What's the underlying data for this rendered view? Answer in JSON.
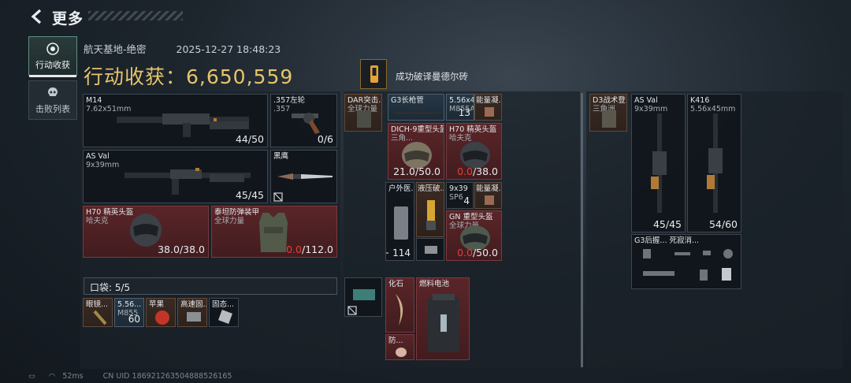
{
  "header": {
    "title": "更多"
  },
  "nav": [
    {
      "label": "行动收获",
      "icon": "target-icon",
      "active": true
    },
    {
      "label": "击败列表",
      "icon": "skull-icon",
      "active": false
    }
  ],
  "summary": {
    "map": "航天基地-绝密",
    "datetime": "2025-12-27 18:48:23",
    "harvest_label": "行动收获：",
    "harvest_value": "6,650,559",
    "achievement": "成功破译曼德尔砖"
  },
  "equipment": {
    "m14": {
      "name": "M14",
      "caliber": "7.62x51mm",
      "ammo": "44/50"
    },
    "revolver": {
      "name": ".357左轮",
      "caliber": ".357",
      "ammo": "0/6"
    },
    "asval": {
      "name": "AS Val",
      "caliber": "9x39mm",
      "ammo": "45/45"
    },
    "knife": {
      "name": "黑鹰"
    },
    "helmet": {
      "name": "H70 精英头盔",
      "sub": "哈夫克",
      "dura_cur": "38.0",
      "dura_max": "/38.0"
    },
    "armor": {
      "name": "泰坦防弹装甲",
      "sub": "全球力量",
      "dura_cur": "0.0",
      "dura_max": "/112.0"
    }
  },
  "pocket": {
    "label": "口袋: 5/5",
    "items": [
      {
        "name": "眼镜...",
        "count": ""
      },
      {
        "name": "5.56...",
        "sub": "M855",
        "count": "60"
      },
      {
        "name": "苹果",
        "count": ""
      },
      {
        "name": "高速固...",
        "count": ""
      },
      {
        "name": "固态...",
        "count": ""
      }
    ]
  },
  "backpack": {
    "items": [
      {
        "name": "DAR突击...",
        "sub": "全球力量"
      },
      {
        "name": "G3长枪管"
      },
      {
        "name": "5.56x4...",
        "sub": "M855A...",
        "count": "13"
      },
      {
        "name": "能量凝..."
      },
      {
        "name": "DICH-9重型头盔",
        "sub": "三角...",
        "dura_cur": "21.0",
        "dura_max": "/50.0"
      },
      {
        "name": "H70 精英头盔",
        "sub": "哈夫克",
        "dura_cur": "0.0",
        "dura_max": "/38.0"
      },
      {
        "name": "户外医...",
        "count": "114"
      },
      {
        "name": "液压破..."
      },
      {
        "name": "9x39",
        "sub": "SP6",
        "count": "4"
      },
      {
        "name": "能量凝..."
      },
      {
        "name": "GN 重型头盔",
        "sub": "全球力量",
        "dura_cur": "0.0",
        "dura_max": "/50.0"
      },
      {
        "name": "化石"
      },
      {
        "name": "燃料电池"
      },
      {
        "name": "防..."
      }
    ]
  },
  "safebox": {
    "items": [
      {
        "name": "D3战术登...",
        "sub": "三角洲"
      },
      {
        "name": "AS Val",
        "sub": "9x39mm",
        "count": "45/45"
      },
      {
        "name": "K416",
        "sub": "5.56x45mm",
        "count": "54/60"
      },
      {
        "name": "G3后握...",
        "sub": ""
      },
      {
        "name": "死寂消..."
      }
    ]
  },
  "footer": {
    "ping": "52ms",
    "uid": "CN UID 186921263504888526165"
  }
}
